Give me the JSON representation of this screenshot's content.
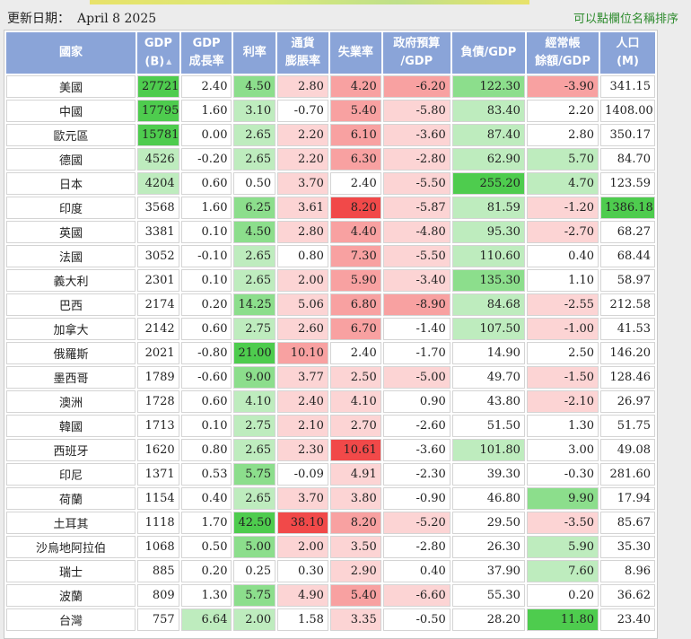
{
  "header": {
    "update_label": "更新日期：",
    "update_date": "April 8 2025",
    "sort_hint": "可以點欄位名稱排序"
  },
  "columns": [
    {
      "key": "country",
      "line1": "國家",
      "line2": ""
    },
    {
      "key": "gdp",
      "line1": "GDP",
      "line2": "(B)",
      "sorted": true
    },
    {
      "key": "gdp_growth",
      "line1": "GDP",
      "line2": "成長率"
    },
    {
      "key": "rate",
      "line1": "利率",
      "line2": ""
    },
    {
      "key": "inflation",
      "line1": "通貨",
      "line2": "膨脹率"
    },
    {
      "key": "unemployment",
      "line1": "失業率",
      "line2": ""
    },
    {
      "key": "budget",
      "line1": "政府預算",
      "line2": "/GDP"
    },
    {
      "key": "debt",
      "line1": "負債/GDP",
      "line2": ""
    },
    {
      "key": "current_account",
      "line1": "經常帳",
      "line2": "餘額/GDP"
    },
    {
      "key": "population",
      "line1": "人口",
      "line2": "(M)"
    }
  ],
  "sort_icon": "sort-ascending-icon",
  "colors": {
    "header_bg": "#8aa4d8",
    "green": [
      69,
      201,
      69
    ],
    "red": [
      240,
      58,
      58
    ]
  },
  "rows": [
    {
      "country": "美國",
      "values": [
        "27721",
        "2.40",
        "4.50",
        "2.80",
        "4.20",
        "-6.20",
        "122.30",
        "-3.90",
        "341.15"
      ]
    },
    {
      "country": "中國",
      "values": [
        "17795",
        "1.60",
        "3.10",
        "-0.70",
        "5.40",
        "-5.80",
        "83.40",
        "2.20",
        "1408.00"
      ]
    },
    {
      "country": "歐元區",
      "values": [
        "15781",
        "0.00",
        "2.65",
        "2.20",
        "6.10",
        "-3.60",
        "87.40",
        "2.80",
        "350.17"
      ]
    },
    {
      "country": "德國",
      "values": [
        "4526",
        "-0.20",
        "2.65",
        "2.20",
        "6.30",
        "-2.80",
        "62.90",
        "5.70",
        "84.70"
      ]
    },
    {
      "country": "日本",
      "values": [
        "4204",
        "0.60",
        "0.50",
        "3.70",
        "2.40",
        "-5.50",
        "255.20",
        "4.70",
        "123.59"
      ]
    },
    {
      "country": "印度",
      "values": [
        "3568",
        "1.60",
        "6.25",
        "3.61",
        "8.20",
        "-5.87",
        "81.59",
        "-1.20",
        "1386.18"
      ]
    },
    {
      "country": "英國",
      "values": [
        "3381",
        "0.10",
        "4.50",
        "2.80",
        "4.40",
        "-4.80",
        "95.30",
        "-2.70",
        "68.27"
      ]
    },
    {
      "country": "法國",
      "values": [
        "3052",
        "-0.10",
        "2.65",
        "0.80",
        "7.30",
        "-5.50",
        "110.60",
        "0.40",
        "68.44"
      ]
    },
    {
      "country": "義大利",
      "values": [
        "2301",
        "0.10",
        "2.65",
        "2.00",
        "5.90",
        "-3.40",
        "135.30",
        "1.10",
        "58.97"
      ]
    },
    {
      "country": "巴西",
      "values": [
        "2174",
        "0.20",
        "14.25",
        "5.06",
        "6.80",
        "-8.90",
        "84.68",
        "-2.55",
        "212.58"
      ]
    },
    {
      "country": "加拿大",
      "values": [
        "2142",
        "0.60",
        "2.75",
        "2.60",
        "6.70",
        "-1.40",
        "107.50",
        "-1.00",
        "41.53"
      ]
    },
    {
      "country": "俄羅斯",
      "values": [
        "2021",
        "-0.80",
        "21.00",
        "10.10",
        "2.40",
        "-1.70",
        "14.90",
        "2.50",
        "146.20"
      ]
    },
    {
      "country": "墨西哥",
      "values": [
        "1789",
        "-0.60",
        "9.00",
        "3.77",
        "2.50",
        "-5.00",
        "49.70",
        "-1.50",
        "128.46"
      ]
    },
    {
      "country": "澳洲",
      "values": [
        "1728",
        "0.60",
        "4.10",
        "2.40",
        "4.10",
        "0.90",
        "43.80",
        "-2.10",
        "26.97"
      ]
    },
    {
      "country": "韓國",
      "values": [
        "1713",
        "0.10",
        "2.75",
        "2.10",
        "2.70",
        "-2.60",
        "51.50",
        "1.30",
        "51.75"
      ]
    },
    {
      "country": "西班牙",
      "values": [
        "1620",
        "0.80",
        "2.65",
        "2.30",
        "10.61",
        "-3.60",
        "101.80",
        "3.00",
        "49.08"
      ]
    },
    {
      "country": "印尼",
      "values": [
        "1371",
        "0.53",
        "5.75",
        "-0.09",
        "4.91",
        "-2.30",
        "39.30",
        "-0.30",
        "281.60"
      ]
    },
    {
      "country": "荷蘭",
      "values": [
        "1154",
        "0.40",
        "2.65",
        "3.70",
        "3.80",
        "-0.90",
        "46.80",
        "9.90",
        "17.94"
      ]
    },
    {
      "country": "土耳其",
      "values": [
        "1118",
        "1.70",
        "42.50",
        "38.10",
        "8.20",
        "-5.20",
        "29.50",
        "-3.50",
        "85.67"
      ]
    },
    {
      "country": "沙烏地阿拉伯",
      "values": [
        "1068",
        "0.50",
        "5.00",
        "2.00",
        "3.50",
        "-2.80",
        "26.30",
        "5.90",
        "35.30"
      ]
    },
    {
      "country": "瑞士",
      "values": [
        "885",
        "0.20",
        "0.25",
        "0.30",
        "2.90",
        "0.40",
        "37.90",
        "7.60",
        "8.96"
      ]
    },
    {
      "country": "波蘭",
      "values": [
        "809",
        "1.30",
        "5.75",
        "4.90",
        "5.40",
        "-6.60",
        "55.30",
        "0.20",
        "36.62"
      ]
    },
    {
      "country": "台灣",
      "values": [
        "757",
        "6.64",
        "2.00",
        "1.58",
        "3.35",
        "-0.50",
        "28.20",
        "11.80",
        "23.40"
      ]
    }
  ],
  "cell_shading": {
    "levels": [
      [
        "g3",
        "",
        "g2",
        "r1",
        "r2",
        "r2",
        "g2",
        "r2",
        ""
      ],
      [
        "g3",
        "",
        "g1",
        "",
        "r2",
        "r1",
        "g1",
        "",
        ""
      ],
      [
        "g3",
        "",
        "g1",
        "r1",
        "r2",
        "r1",
        "g1",
        "",
        ""
      ],
      [
        "g1",
        "",
        "g1",
        "r1",
        "r2",
        "r1",
        "g1",
        "g1",
        ""
      ],
      [
        "g1",
        "",
        "",
        "r1",
        "",
        "r1",
        "g3",
        "g1",
        ""
      ],
      [
        "",
        "",
        "g2",
        "r1",
        "r3",
        "r1",
        "g1",
        "r1",
        "g3"
      ],
      [
        "",
        "",
        "g2",
        "r1",
        "r2",
        "r1",
        "g1",
        "r1",
        ""
      ],
      [
        "",
        "",
        "g1",
        "",
        "r2",
        "r1",
        "g1",
        "",
        ""
      ],
      [
        "",
        "",
        "g1",
        "r1",
        "r2",
        "r1",
        "g2",
        "",
        ""
      ],
      [
        "",
        "",
        "g2",
        "r1",
        "r2",
        "r2",
        "g1",
        "r1",
        ""
      ],
      [
        "",
        "",
        "g1",
        "r1",
        "r2",
        "",
        "g1",
        "r1",
        ""
      ],
      [
        "",
        "",
        "g3",
        "r2",
        "",
        "",
        "",
        "",
        ""
      ],
      [
        "",
        "",
        "g2",
        "r1",
        "r1",
        "r1",
        "",
        "r1",
        ""
      ],
      [
        "",
        "",
        "g1",
        "r1",
        "r1",
        "",
        "",
        "r1",
        ""
      ],
      [
        "",
        "",
        "g1",
        "r1",
        "r1",
        "",
        "",
        "",
        ""
      ],
      [
        "",
        "",
        "g1",
        "r1",
        "r3",
        "",
        "g1",
        "",
        ""
      ],
      [
        "",
        "",
        "g2",
        "",
        "r1",
        "",
        "",
        "",
        ""
      ],
      [
        "",
        "",
        "g1",
        "r1",
        "r1",
        "",
        "",
        "g2",
        ""
      ],
      [
        "",
        "",
        "g3",
        "r3",
        "r2",
        "r1",
        "",
        "r1",
        ""
      ],
      [
        "",
        "",
        "g2",
        "r1",
        "r1",
        "",
        "",
        "g1",
        ""
      ],
      [
        "",
        "",
        "",
        "",
        "r1",
        "",
        "",
        "g1",
        ""
      ],
      [
        "",
        "",
        "g2",
        "r1",
        "r2",
        "r1",
        "",
        "",
        ""
      ],
      [
        "",
        "g1",
        "g1",
        "",
        "r1",
        "",
        "",
        "g3",
        ""
      ]
    ]
  }
}
